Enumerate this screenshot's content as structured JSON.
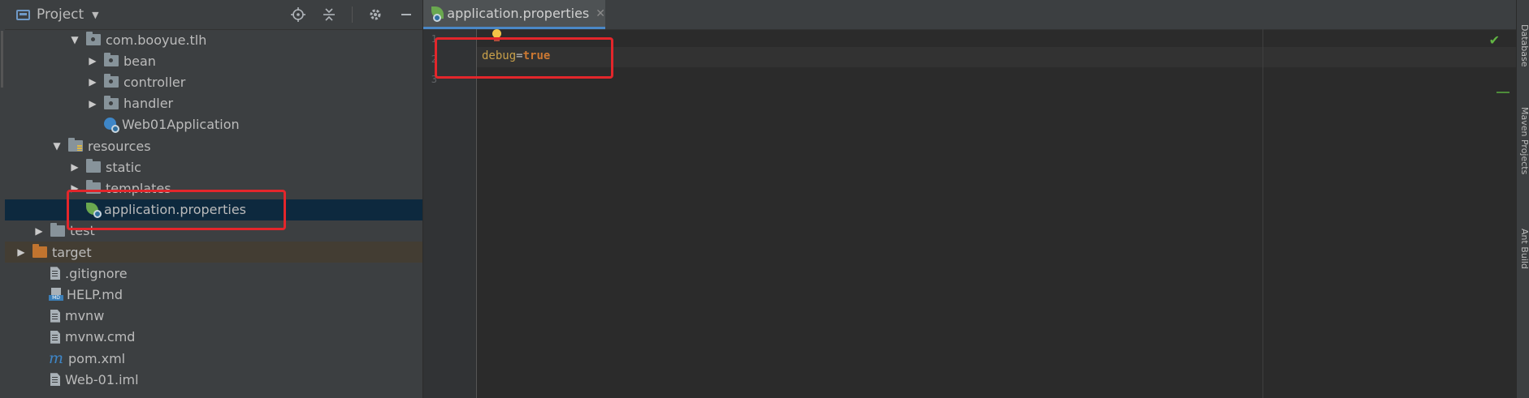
{
  "project_panel": {
    "title": "Project",
    "tools": [
      "locate-icon",
      "collapse-all-icon",
      "gear-icon",
      "minimize-icon"
    ],
    "tree": [
      {
        "label": "com.booyue.tlh",
        "kind": "package",
        "depth": 3,
        "expanded": true
      },
      {
        "label": "bean",
        "kind": "package",
        "depth": 4,
        "expanded": false
      },
      {
        "label": "controller",
        "kind": "package",
        "depth": 4,
        "expanded": false
      },
      {
        "label": "handler",
        "kind": "package",
        "depth": 4,
        "expanded": false
      },
      {
        "label": "Web01Application",
        "kind": "spring-app",
        "depth": 4
      },
      {
        "label": "resources",
        "kind": "resources",
        "depth": 2,
        "expanded": true
      },
      {
        "label": "static",
        "kind": "folder",
        "depth": 3,
        "expanded": false
      },
      {
        "label": "templates",
        "kind": "folder",
        "depth": 3,
        "expanded": false
      },
      {
        "label": "application.properties",
        "kind": "spring-props",
        "depth": 3,
        "selected": true
      },
      {
        "label": "test",
        "kind": "folder",
        "depth": 1,
        "expanded": false
      },
      {
        "label": "target",
        "kind": "excluded-folder",
        "depth": 0,
        "expanded": false
      },
      {
        "label": ".gitignore",
        "kind": "file",
        "depth": 1
      },
      {
        "label": "HELP.md",
        "kind": "markdown",
        "depth": 1
      },
      {
        "label": "mvnw",
        "kind": "file",
        "depth": 1
      },
      {
        "label": "mvnw.cmd",
        "kind": "file",
        "depth": 1
      },
      {
        "label": "pom.xml",
        "kind": "maven",
        "depth": 1
      },
      {
        "label": "Web-01.iml",
        "kind": "file",
        "depth": 1
      }
    ]
  },
  "editor": {
    "tab_label": "application.properties",
    "line_numbers": [
      "1",
      "2",
      "3"
    ],
    "code_key": "debug",
    "code_eq": "=",
    "code_value": "true"
  },
  "right_tools": [
    "Database",
    "Maven Projects",
    "Ant Build"
  ],
  "colors": {
    "highlight": "#e3262b",
    "selection": "#0d293e",
    "accent": "#4a88c7"
  }
}
